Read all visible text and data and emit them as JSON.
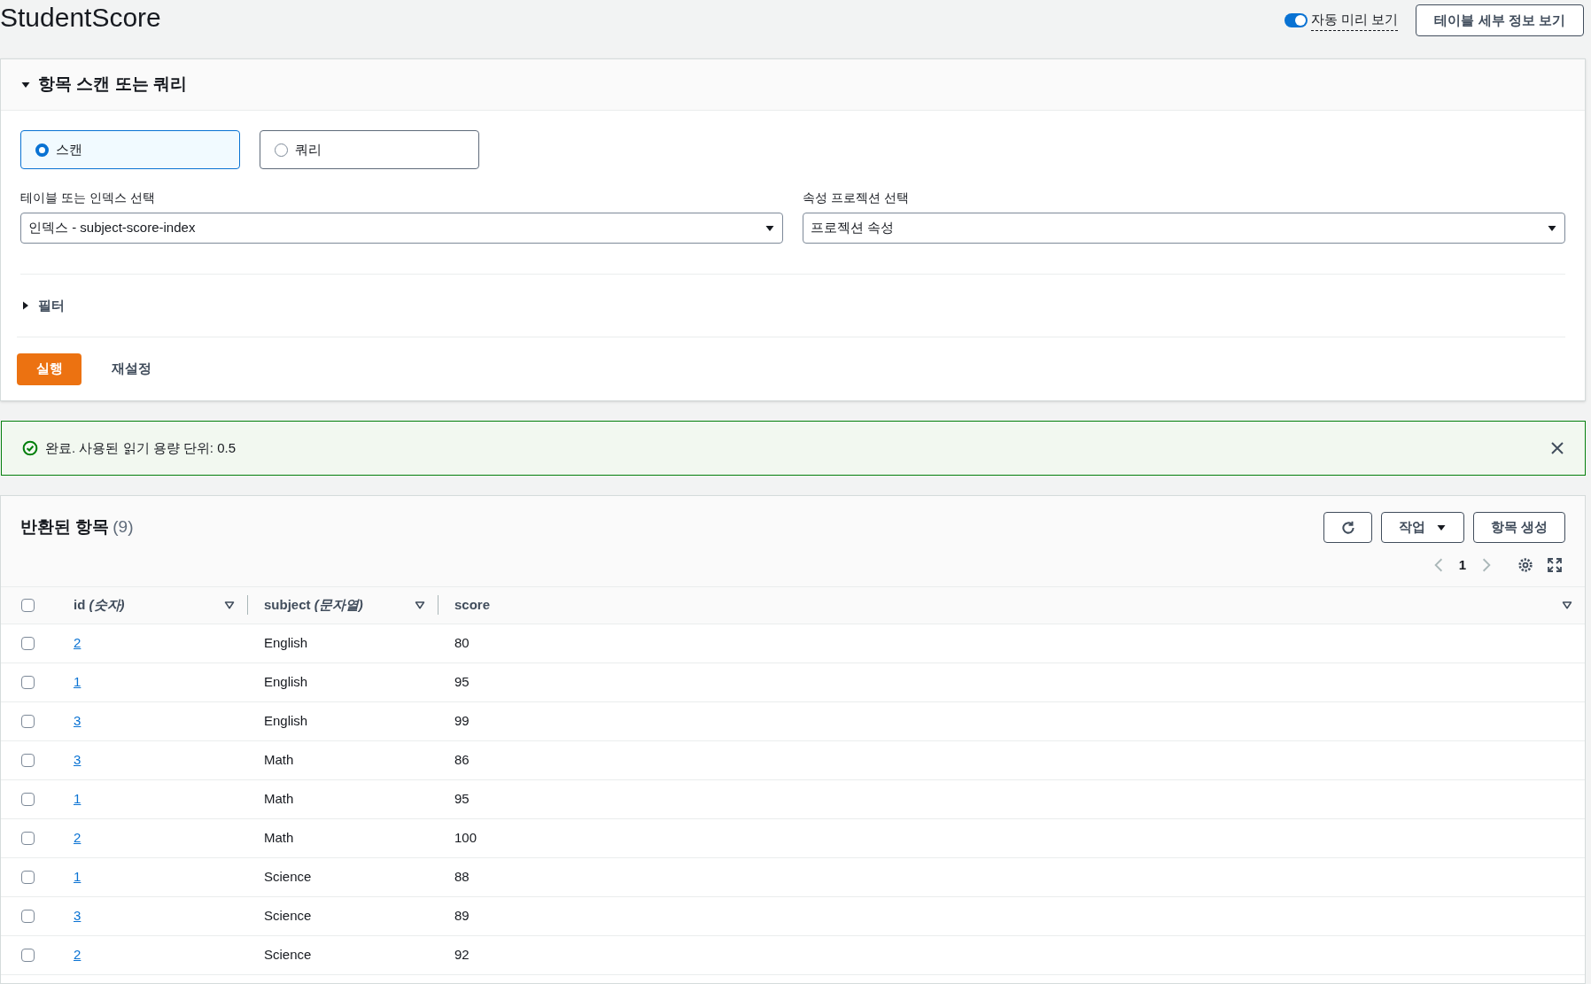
{
  "page": {
    "title": "StudentScore",
    "auto_preview": {
      "label": "자동 미리 보기",
      "on": true
    },
    "details_button": "테이블 세부 정보 보기"
  },
  "scan_panel": {
    "title": "항목 스캔 또는 쿼리",
    "expanded": true,
    "modes": [
      {
        "label": "스캔",
        "selected": true
      },
      {
        "label": "쿼리",
        "selected": false
      }
    ],
    "selects": [
      {
        "label": "테이블 또는 인덱스 선택",
        "value": "인덱스 - subject-score-index"
      },
      {
        "label": "속성 프로젝션 선택",
        "value": "프로젝션 속성"
      }
    ],
    "filter": {
      "label": "필터",
      "expanded": false
    },
    "run_button": "실행",
    "reset_button": "재설정"
  },
  "flash": {
    "message": "완료. 사용된 읽기 용량 단위: 0.5"
  },
  "results": {
    "title": "반환된 항목",
    "count": "(9)",
    "actions_button": "작업",
    "create_button": "항목 생성",
    "page": "1",
    "select_all_checked": false,
    "columns": [
      {
        "name": "id",
        "type": "(숫자)"
      },
      {
        "name": "subject",
        "type": "(문자열)"
      },
      {
        "name": "score"
      }
    ],
    "rows": [
      {
        "checked": false,
        "id": "2",
        "subject": "English",
        "score": "80"
      },
      {
        "checked": false,
        "id": "1",
        "subject": "English",
        "score": "95"
      },
      {
        "checked": false,
        "id": "3",
        "subject": "English",
        "score": "99"
      },
      {
        "checked": false,
        "id": "3",
        "subject": "Math",
        "score": "86"
      },
      {
        "checked": false,
        "id": "1",
        "subject": "Math",
        "score": "95"
      },
      {
        "checked": false,
        "id": "2",
        "subject": "Math",
        "score": "100"
      },
      {
        "checked": false,
        "id": "1",
        "subject": "Science",
        "score": "88"
      },
      {
        "checked": false,
        "id": "3",
        "subject": "Science",
        "score": "89"
      },
      {
        "checked": false,
        "id": "2",
        "subject": "Science",
        "score": "92"
      }
    ]
  }
}
